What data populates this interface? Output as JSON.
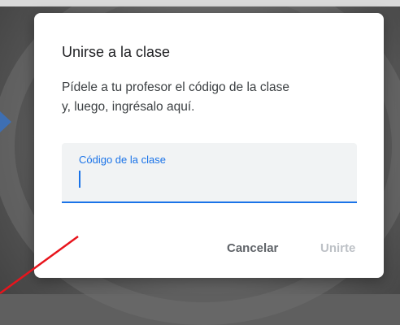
{
  "dialog": {
    "title": "Unirse a la clase",
    "description_line1": "Pídele a tu profesor el código de la clase",
    "description_line2": "y, luego, ingrésalo aquí.",
    "code_field_label": "Código de la clase",
    "code_field_value": "",
    "cancel_label": "Cancelar",
    "join_label": "Unirte"
  },
  "colors": {
    "accent": "#1a73e8",
    "annotation_arrow": "#3e6fb3",
    "annotation_line": "#e8141c"
  }
}
